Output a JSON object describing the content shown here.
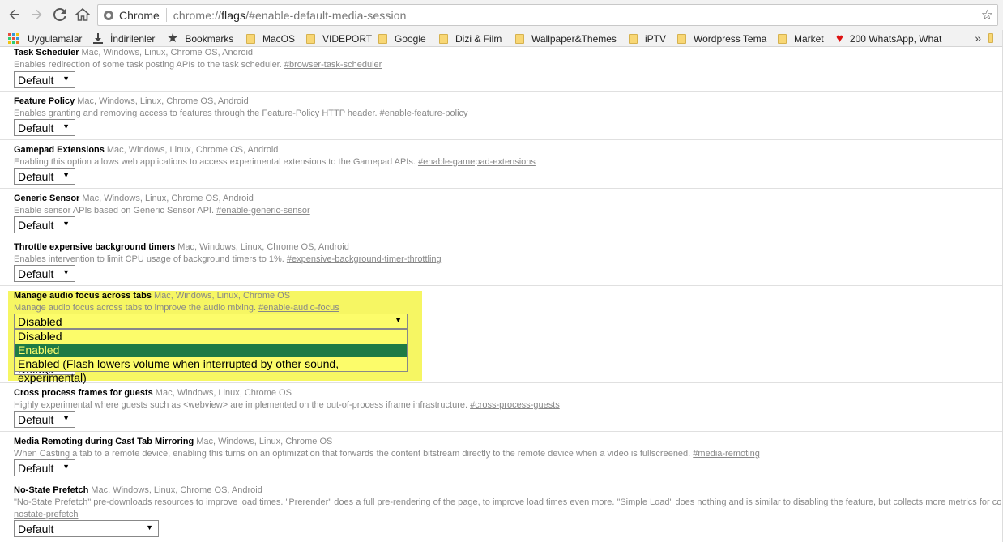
{
  "browser": {
    "site_chip": "Chrome",
    "url_prefix": "chrome://",
    "url_host": "flags",
    "url_path": "/#enable-default-media-session"
  },
  "bookmarks": {
    "items": [
      {
        "label": "Uygulamalar",
        "icon": "apps-grid-icon"
      },
      {
        "label": "İndirilenler",
        "icon": "download-icon"
      },
      {
        "label": "Bookmarks",
        "icon": "star-icon"
      },
      {
        "label": "MacOS",
        "icon": "folder-icon"
      },
      {
        "label": "VIDEPORT",
        "icon": "folder-icon"
      },
      {
        "label": "Google",
        "icon": "folder-icon"
      },
      {
        "label": "Dizi & Film",
        "icon": "folder-icon"
      },
      {
        "label": "Wallpaper&Themes",
        "icon": "folder-icon"
      },
      {
        "label": "iPTV",
        "icon": "folder-icon"
      },
      {
        "label": "Wordpress Tema",
        "icon": "folder-icon"
      },
      {
        "label": "Market",
        "icon": "folder-icon"
      },
      {
        "label": "200 WhatsApp, What",
        "icon": "heart-icon"
      }
    ],
    "overflow": "»"
  },
  "flags": [
    {
      "name": "Task Scheduler",
      "platforms": "Mac, Windows, Linux, Chrome OS, Android",
      "desc": "Enables redirection of some task posting APIs to the task scheduler.",
      "anchor": "#browser-task-scheduler",
      "value": "Default"
    },
    {
      "name": "Feature Policy",
      "platforms": "Mac, Windows, Linux, Chrome OS, Android",
      "desc": "Enables granting and removing access to features through the Feature-Policy HTTP header.",
      "anchor": "#enable-feature-policy",
      "value": "Default"
    },
    {
      "name": "Gamepad Extensions",
      "platforms": "Mac, Windows, Linux, Chrome OS, Android",
      "desc": "Enabling this option allows web applications to access experimental extensions to the Gamepad APIs.",
      "anchor": "#enable-gamepad-extensions",
      "value": "Default"
    },
    {
      "name": "Generic Sensor",
      "platforms": "Mac, Windows, Linux, Chrome OS, Android",
      "desc": "Enable sensor APIs based on Generic Sensor API.",
      "anchor": "#enable-generic-sensor",
      "value": "Default"
    },
    {
      "name": "Throttle expensive background timers",
      "platforms": "Mac, Windows, Linux, Chrome OS, Android",
      "desc": "Enables intervention to limit CPU usage of background timers to 1%.",
      "anchor": "#expensive-background-timer-throttling",
      "value": "Default"
    },
    {
      "name": "Manage audio focus across tabs",
      "platforms": "Mac, Windows, Linux, Chrome OS",
      "desc": "Manage audio focus across tabs to improve the audio mixing.",
      "anchor": "#enable-audio-focus",
      "value": "Disabled"
    },
    {
      "name": "",
      "platforms": "",
      "desc": "",
      "anchor": "",
      "value": "Default"
    },
    {
      "name": "Cross process frames for guests",
      "platforms": "Mac, Windows, Linux, Chrome OS",
      "desc": "Highly experimental where guests such as <webview> are implemented on the out-of-process iframe infrastructure.",
      "anchor": "#cross-process-guests",
      "value": "Default"
    },
    {
      "name": "Media Remoting during Cast Tab Mirroring",
      "platforms": "Mac, Windows, Linux, Chrome OS",
      "desc": "When Casting a tab to a remote device, enabling this turns on an optimization that forwards the content bitstream directly to the remote device when a video is fullscreened.",
      "anchor": "#media-remoting",
      "value": "Default"
    },
    {
      "name": "No-State Prefetch",
      "platforms": "Mac, Windows, Linux, Chrome OS, Android",
      "desc": "\"No-State Prefetch\" pre-downloads resources to improve load times. \"Prerender\" does a full pre-rendering of the page, to improve load times even more. \"Simple Load\" does nothing and is similar to disabling the feature, but collects more metrics for comparison",
      "anchor": "nostate-prefetch",
      "value": "Default"
    }
  ],
  "dropdown": {
    "options": [
      "Disabled",
      "Enabled",
      "Enabled (Flash lowers volume when interrupted by other sound, experimental)"
    ],
    "selected_index": 1
  },
  "colors": {
    "highlight": "#f6f663",
    "selected_option_bg": "#1e7b45"
  }
}
